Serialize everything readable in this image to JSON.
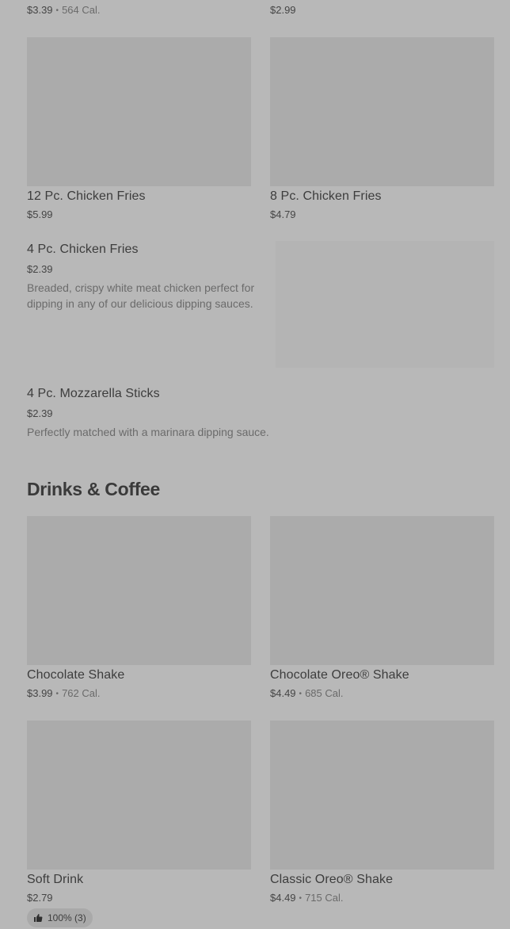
{
  "top_row": {
    "left": {
      "price": "$3.39",
      "calories": "564 Cal."
    },
    "right": {
      "price": "$2.99"
    }
  },
  "snacks_grid": [
    {
      "name": "12 Pc. Chicken Fries",
      "price": "$5.99"
    },
    {
      "name": "8 Pc. Chicken Fries",
      "price": "$4.79"
    }
  ],
  "list_items": [
    {
      "name": "4 Pc. Chicken Fries",
      "price": "$2.39",
      "description": "Breaded, crispy white meat chicken perfect for dipping in any of our delicious dipping sauces."
    },
    {
      "name": "4 Pc. Mozzarella Sticks",
      "price": "$2.39",
      "description": "Perfectly matched with a marinara dipping sauce."
    }
  ],
  "drinks_section": {
    "title": "Drinks & Coffee",
    "items": [
      {
        "name": "Chocolate Shake",
        "price": "$3.99",
        "calories": "762 Cal."
      },
      {
        "name": "Chocolate Oreo® Shake",
        "price": "$4.49",
        "calories": "685 Cal."
      },
      {
        "name": "Soft Drink",
        "price": "$2.79",
        "rating": "100% (3)"
      },
      {
        "name": "Classic Oreo® Shake",
        "price": "$4.49",
        "calories": "715 Cal."
      }
    ]
  },
  "separator": "•",
  "icons": {
    "rating": "thumbs-up-icon"
  },
  "colors": {
    "background": "#b8b8b8",
    "image_placeholder": "#ababab"
  }
}
